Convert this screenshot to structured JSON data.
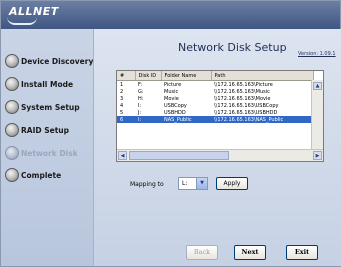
{
  "header": {
    "logo_text": "ALLNET"
  },
  "sidebar": {
    "items": [
      {
        "label": "Device Discovery",
        "active": false
      },
      {
        "label": "Install Mode",
        "active": false
      },
      {
        "label": "System Setup",
        "active": false
      },
      {
        "label": "RAID Setup",
        "active": false
      },
      {
        "label": "Network Disk",
        "active": true
      },
      {
        "label": "Complete",
        "active": false
      }
    ]
  },
  "main": {
    "title": "Network Disk Setup",
    "version": "Version: 1.09.1",
    "table": {
      "columns": [
        "#",
        "Disk ID",
        "Folder Name",
        "Path"
      ],
      "rows": [
        {
          "num": "1",
          "disk": "F:",
          "folder": "Picture",
          "path": "\\\\172.16.65.163\\Picture",
          "selected": false
        },
        {
          "num": "2",
          "disk": "G:",
          "folder": "Music",
          "path": "\\\\172.16.65.163\\Music",
          "selected": false
        },
        {
          "num": "3",
          "disk": "H:",
          "folder": "Movie",
          "path": "\\\\172.16.65.163\\Movie",
          "selected": false
        },
        {
          "num": "4",
          "disk": "I:",
          "folder": "USBCopy",
          "path": "\\\\172.16.65.163\\USBCopy",
          "selected": false
        },
        {
          "num": "5",
          "disk": "J:",
          "folder": "USBHDD",
          "path": "\\\\172.16.65.163\\USBHDD",
          "selected": false
        },
        {
          "num": "6",
          "disk": "I:",
          "folder": "NAS_Public",
          "path": "\\\\172.16.65.163\\NAS_Public",
          "selected": true
        }
      ]
    },
    "mapping_label": "Mapping to",
    "mapping_value": "L:",
    "apply_label": "Apply"
  },
  "footer": {
    "back_label": "Back",
    "next_label": "Next",
    "exit_label": "Exit"
  },
  "colors": {
    "selection": "#3168c6",
    "header": "#3f5683"
  }
}
